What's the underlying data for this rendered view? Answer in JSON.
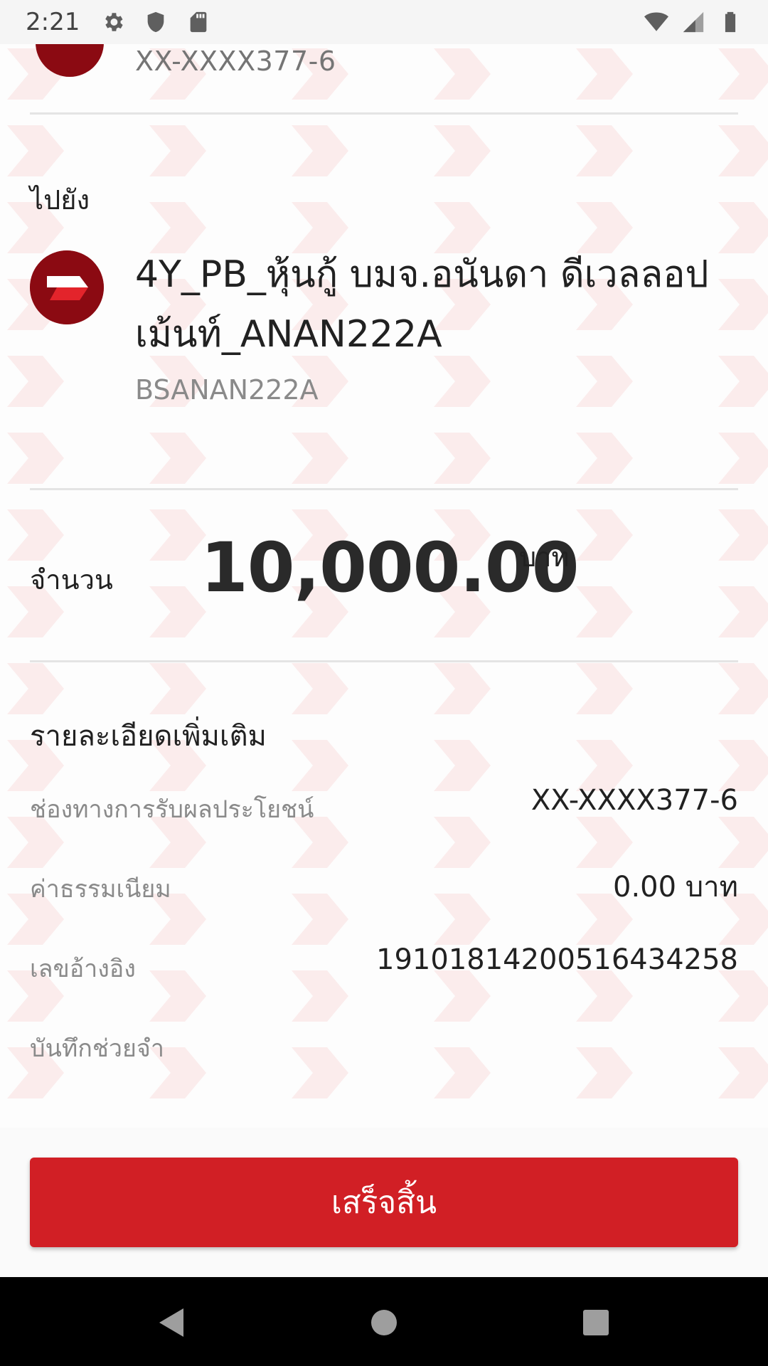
{
  "status_bar": {
    "time": "2:21",
    "left_icons": [
      "gear-icon",
      "shield-icon",
      "sd-card-icon"
    ],
    "right_icons": [
      "wifi-icon",
      "signal-icon",
      "battery-icon"
    ]
  },
  "from": {
    "account_masked": "XX-XXXX377-6"
  },
  "to": {
    "label": "ไปยัง",
    "name": "4Y_PB_หุ้นกู้ บมจ.อนันดา ดีเวลลอปเม้นท์_ANAN222A",
    "code": "BSANAN222A"
  },
  "amount": {
    "label": "จำนวน",
    "value": "10,000.00",
    "unit": "บาท"
  },
  "details": {
    "title": "รายละเอียดเพิ่มเติม",
    "rows": [
      {
        "label": "ช่องทางการรับผลประโยชน์",
        "value": "XX-XXXX377-6"
      },
      {
        "label": "ค่าธรรมเนียม",
        "value": "0.00 บาท"
      },
      {
        "label": "เลขอ้างอิง",
        "value": "19101814200516434258"
      },
      {
        "label": "บันทึกช่วยจำ",
        "value": ""
      }
    ]
  },
  "done_button": {
    "label": "เสร็จสิ้น"
  },
  "colors": {
    "brand_red": "#d11f25",
    "logo_dark_red": "#8b0a12",
    "watermark": "#fdf0f0"
  },
  "nav_bar": {
    "buttons": [
      "back-icon",
      "home-icon",
      "recents-icon"
    ]
  }
}
